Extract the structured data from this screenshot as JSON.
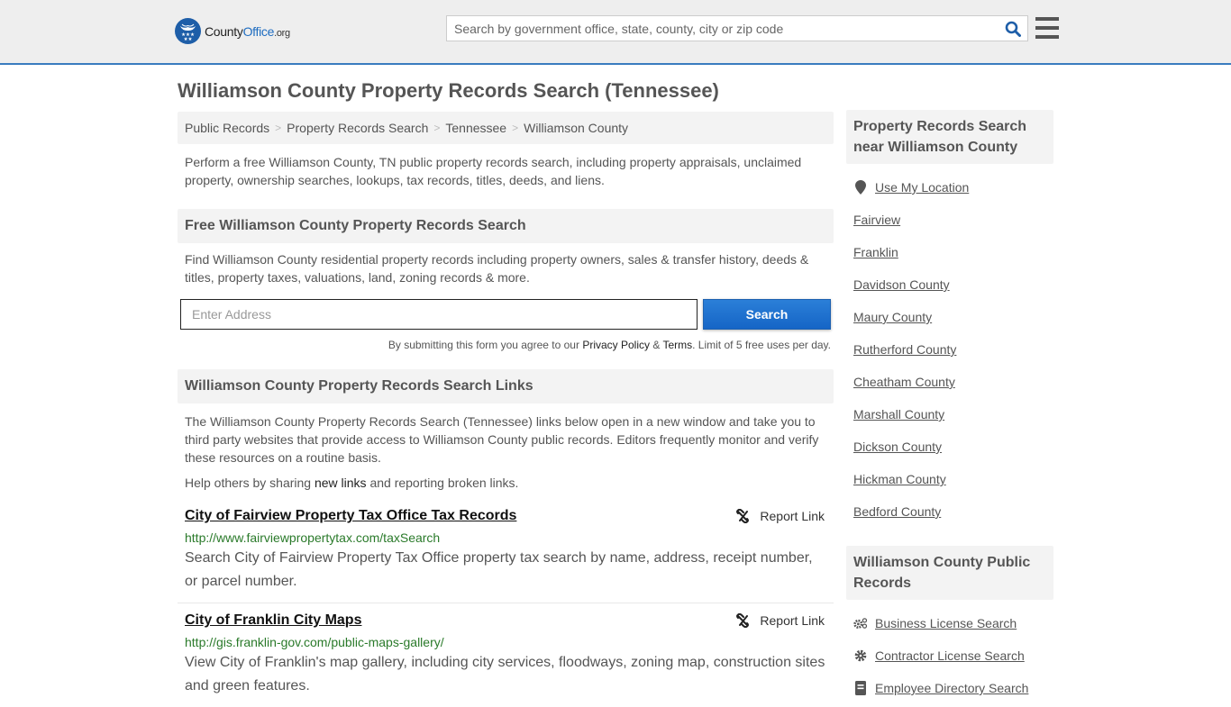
{
  "header": {
    "logo": {
      "brand_a": "County",
      "brand_b": "Office",
      "brand_c": ".org"
    },
    "search_placeholder": "Search by government office, state, county, city or zip code",
    "search_icon": "search-icon",
    "menu_icon": "hamburger-menu-icon"
  },
  "page_title": "Williamson County Property Records Search (Tennessee)",
  "breadcrumb": [
    "Public Records",
    "Property Records Search",
    "Tennessee",
    "Williamson County"
  ],
  "breadcrumb_separator": ">",
  "intro": "Perform a free Williamson County, TN public property records search, including property appraisals, unclaimed property, ownership searches, lookups, tax records, titles, deeds, and liens.",
  "free_search": {
    "heading": "Free Williamson County Property Records Search",
    "description": "Find Williamson County residential property records including property owners, sales & transfer history, deeds & titles, property taxes, valuations, land, zoning records & more.",
    "address_placeholder": "Enter Address",
    "search_button": "Search",
    "disclaimer_pre": "By submitting this form you agree to our ",
    "privacy_link": "Privacy Policy",
    "amp": " & ",
    "terms_link": "Terms",
    "disclaimer_post": ". Limit of 5 free uses per day."
  },
  "links_section": {
    "heading": "Williamson County Property Records Search Links",
    "description": "The Williamson County Property Records Search (Tennessee) links below open in a new window and take you to third party websites that provide access to Williamson County public records. Editors frequently monitor and verify these resources on a routine basis.",
    "help_pre": "Help others by sharing ",
    "help_link": "new links",
    "help_post": " and reporting broken links.",
    "report_label": "Report Link",
    "items": [
      {
        "title": "City of Fairview Property Tax Office Tax Records",
        "url": "http://www.fairviewpropertytax.com/taxSearch",
        "description": "Search City of Fairview Property Tax Office property tax search by name, address, receipt number, or parcel number."
      },
      {
        "title": "City of Franklin City Maps",
        "url": "http://gis.franklin-gov.com/public-maps-gallery/",
        "description": "View City of Franklin's map gallery, including city services, floodways, zoning map, construction sites and green features."
      }
    ]
  },
  "sidebar": {
    "nearby_heading": "Property Records Search near Williamson County",
    "use_location": "Use My Location",
    "nearby": [
      "Fairview",
      "Franklin",
      "Davidson County",
      "Maury County",
      "Rutherford County",
      "Cheatham County",
      "Marshall County",
      "Dickson County",
      "Hickman County",
      "Bedford County"
    ],
    "public_records_heading": "Williamson County Public Records",
    "public_records": [
      {
        "label": "Business License Search",
        "icon": "gears-icon"
      },
      {
        "label": "Contractor License Search",
        "icon": "gear-icon"
      },
      {
        "label": "Employee Directory Search",
        "icon": "address-book-icon"
      }
    ]
  }
}
